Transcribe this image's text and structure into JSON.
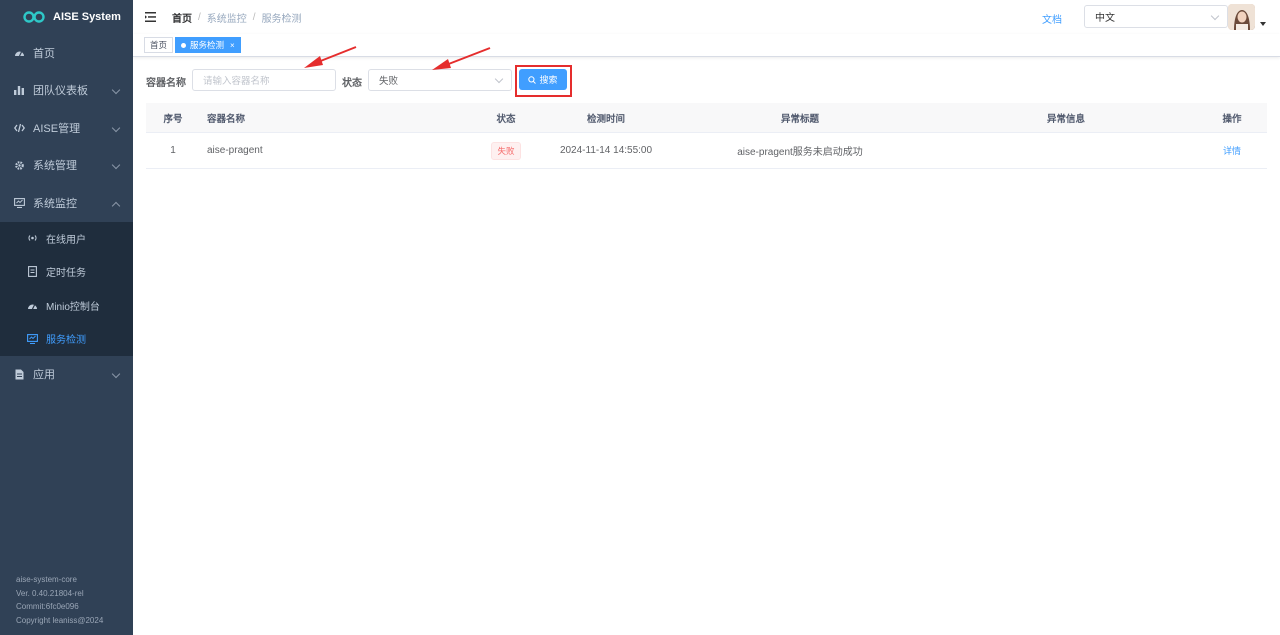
{
  "app": {
    "title": "AISE System"
  },
  "sidebar": {
    "items": [
      {
        "label": "首页",
        "icon": "dashboard-icon",
        "has_children": false
      },
      {
        "label": "团队仪表板",
        "icon": "bar-chart-icon",
        "has_children": true
      },
      {
        "label": "AISE管理",
        "icon": "code-icon",
        "has_children": true
      },
      {
        "label": "系统管理",
        "icon": "gear-icon",
        "has_children": true
      },
      {
        "label": "系统监控",
        "icon": "monitor-icon",
        "has_children": true,
        "expanded": true
      }
    ],
    "monitor_children": [
      {
        "label": "在线用户",
        "icon": "online-icon"
      },
      {
        "label": "定时任务",
        "icon": "job-icon"
      },
      {
        "label": "Minio控制台",
        "icon": "dashboard-icon"
      },
      {
        "label": "服务检测",
        "icon": "monitor-icon",
        "active": true
      }
    ],
    "app_item": {
      "label": "应用",
      "icon": "document-icon"
    },
    "footer": {
      "line1": "aise-system-core",
      "line2": "Ver. 0.40.21804-rel",
      "line3": "Commit:6fc0e096",
      "line4": "Copyright leaniss@2024"
    }
  },
  "navbar": {
    "breadcrumb": [
      "首页",
      "系统监控",
      "服务检测"
    ],
    "doc_link": "文档",
    "language": "中文"
  },
  "tags": {
    "home": "首页",
    "current": "服务检测",
    "close": "×"
  },
  "search": {
    "container_label": "容器名称",
    "container_placeholder": "请输入容器名称",
    "status_label": "状态",
    "status_value": "失败",
    "search_button": "搜索"
  },
  "table": {
    "columns": [
      "序号",
      "容器名称",
      "状态",
      "检测时间",
      "异常标题",
      "异常信息",
      "操作"
    ],
    "rows": [
      {
        "index": "1",
        "container": "aise-pragent",
        "status": "失败",
        "time": "2024-11-14 14:55:00",
        "title": "aise-pragent服务未启动成功",
        "message": "",
        "action": "详情"
      }
    ]
  },
  "colors": {
    "sidebar_bg": "#304156",
    "submenu_bg": "#1f2d3d",
    "accent": "#409eff",
    "annotation_red": "#e52d2d",
    "fail_text": "#f56c6c"
  }
}
